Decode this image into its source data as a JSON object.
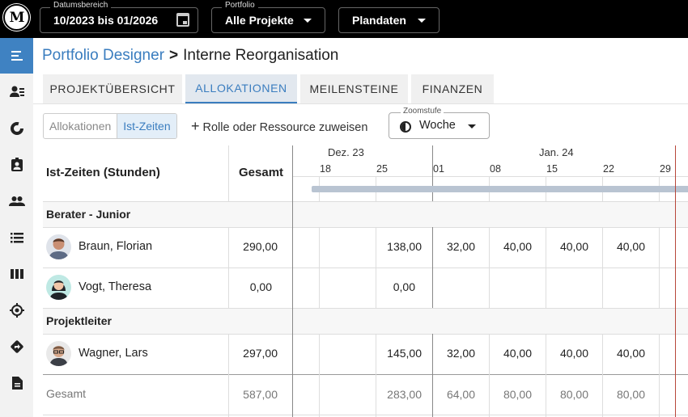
{
  "topbar": {
    "logo": "M",
    "date_range": {
      "label": "Datumsbereich",
      "value": "10/2023 bis 01/2026",
      "icon": "calendar-icon"
    },
    "portfolio": {
      "label": "Portfolio",
      "value": "Alle Projekte"
    },
    "plan": {
      "value": "Plandaten"
    }
  },
  "sidebar": {
    "items": [
      {
        "icon": "menu-icon",
        "active": true
      },
      {
        "icon": "person-list-icon"
      },
      {
        "icon": "donut-icon"
      },
      {
        "icon": "badge-icon"
      },
      {
        "icon": "people-icon"
      },
      {
        "icon": "list-icon"
      },
      {
        "icon": "columns-icon"
      },
      {
        "icon": "target-icon"
      },
      {
        "icon": "direction-icon"
      },
      {
        "icon": "document-icon"
      }
    ]
  },
  "breadcrumb": {
    "portfolio": "Portfolio Designer",
    "separator": ">",
    "project": "Interne Reorganisation"
  },
  "tabs": [
    {
      "label": "PROJEKTÜBERSICHT"
    },
    {
      "label": "ALLOKATIONEN",
      "active": true
    },
    {
      "label": "MEILENSTEINE"
    },
    {
      "label": "FINANZEN"
    }
  ],
  "toolbar": {
    "seg_allocations": "Allokationen",
    "seg_actuals": "Ist-Zeiten",
    "assign_plus": "+",
    "assign_label": "Rolle oder Ressource zuweisen",
    "zoom_label": "Zoomstufe",
    "zoom_value": "Woche"
  },
  "table": {
    "row_header": "Ist-Zeiten (Stunden)",
    "total_header": "Gesamt",
    "months": [
      "Dez. 23",
      "Jan. 24"
    ],
    "weeks": [
      "18",
      "25",
      "01",
      "08",
      "15",
      "22",
      "29"
    ],
    "groups": [
      {
        "name": "Berater - Junior"
      },
      {
        "name": "Projektleiter"
      }
    ],
    "rows": [
      {
        "name": "Braun, Florian",
        "total": "290,00",
        "w25": "138,00",
        "w01": "32,00",
        "w08": "40,00",
        "w15": "40,00",
        "w22": "40,00"
      },
      {
        "name": "Vogt, Theresa",
        "total": "0,00",
        "w25": "0,00",
        "w01": "",
        "w08": "",
        "w15": "",
        "w22": ""
      },
      {
        "name": "Wagner, Lars",
        "total": "297,00",
        "w25": "145,00",
        "w01": "32,00",
        "w08": "40,00",
        "w15": "40,00",
        "w22": "40,00"
      }
    ],
    "totals": {
      "label": "Gesamt",
      "total": "587,00",
      "w25": "283,00",
      "w01": "64,00",
      "w08": "80,00",
      "w15": "80,00",
      "w22": "80,00"
    }
  },
  "colors": {
    "accent": "#3a7dbf",
    "today_line": "#b8473a",
    "timeline_bar": "#b9c4d2"
  }
}
